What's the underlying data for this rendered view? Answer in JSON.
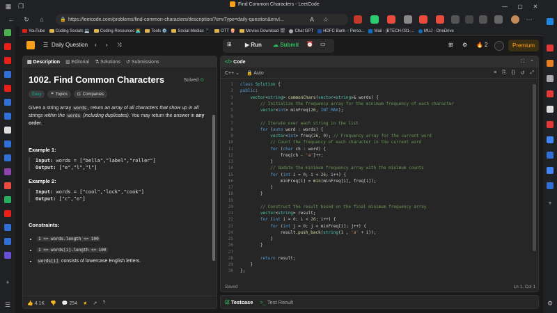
{
  "browser": {
    "tab_title": "Find Common Characters - LeetCode",
    "url": "https://leetcode.com/problems/find-common-characters/description/?envType=daily-question&envI..."
  },
  "bookmarks": [
    {
      "label": "YouTube",
      "icon": "youtube"
    },
    {
      "label": "Coding Socials 💻",
      "icon": "folder"
    },
    {
      "label": "Coding Resources 👨‍💻",
      "icon": "folder"
    },
    {
      "label": "Tools ⚙️",
      "icon": "folder"
    },
    {
      "label": "Social Medias 📱",
      "icon": "folder"
    },
    {
      "label": "OTT 🍿",
      "icon": "folder"
    },
    {
      "label": "Movies Download 🎬",
      "icon": "folder"
    },
    {
      "label": "Chat GPT",
      "icon": "gpt"
    },
    {
      "label": "HDFC Bank – Perso...",
      "icon": "bank"
    },
    {
      "label": "Mail - [BTECH-031-...",
      "icon": "mail"
    },
    {
      "label": "MUJ - OneDrive",
      "icon": "cloud"
    }
  ],
  "lcnav": {
    "daily": "Daily Question",
    "run": "Run",
    "submit": "Submit",
    "streak": "2",
    "premium": "Premium"
  },
  "left": {
    "tabs": [
      "Description",
      "Editorial",
      "Solutions",
      "Submissions"
    ],
    "title": "1002. Find Common Characters",
    "status": "Solved",
    "chips": [
      "Easy",
      "Topics",
      "Companies"
    ],
    "desc": {
      "p1": "Given a string array",
      "c1": "words",
      "p2": ", return",
      "em1": "an array of all characters that show up in all strings within the",
      "c2": "words",
      "em2": "(including duplicates)",
      "p3": ". You may return the answer in",
      "b1": "any order",
      "p4": "."
    },
    "example1": {
      "title": "Example 1:",
      "input_label": "Input:",
      "input": "words = [\"bella\",\"label\",\"roller\"]",
      "output_label": "Output:",
      "output": "[\"e\",\"l\",\"l\"]"
    },
    "example2": {
      "title": "Example 2:",
      "input_label": "Input:",
      "input": "words = [\"cool\",\"lock\",\"cook\"]",
      "output_label": "Output:",
      "output": "[\"c\",\"o\"]"
    },
    "constraints": {
      "title": "Constraints:",
      "c1": "1 <= words.length <= 100",
      "c2": "1 <= words[i].length <= 100",
      "c3_code": "words[i]",
      "c3_text": "consists of lowercase English letters."
    },
    "footer": {
      "likes": "4.1K",
      "comments": "254"
    }
  },
  "code": {
    "title": "Code",
    "language": "C++",
    "mode": "Auto",
    "status": "Saved",
    "cursor": "Ln 1, Col 1",
    "lines": [
      "class Solution {",
      "public:",
      "    vector<string> commonChars(vector<string>& words) {",
      "        // Initialize the frequency array for the minimum frequency of each character",
      "        vector<int> minFreq(26, INT_MAX);",
      "",
      "        // Iterate over each string in the list",
      "        for (auto word : words) {",
      "            vector<int> freq(26, 0); // Frequency array for the current word",
      "            // Count the frequency of each character in the current word",
      "            for (char ch : word) {",
      "                freq[ch - 'a']++;",
      "            }",
      "            // Update the minimum frequency array with the minimum counts",
      "            for (int i = 0; i < 26; i++) {",
      "                minFreq[i] = min(minFreq[i], freq[i]);",
      "            }",
      "        }",
      "",
      "        // Construct the result based on the final minimum frequency array",
      "        vector<string> result;",
      "        for (int i = 0; i < 26; i++) {",
      "            for (int j = 0; j < minFreq[i]; j++) {",
      "                result.push_back(string(1 , 'a' + i));",
      "            }",
      "        }",
      "",
      "        return result;",
      "    }",
      "};"
    ]
  },
  "bottom": {
    "testcase": "Testcase",
    "result": "Test Result"
  }
}
